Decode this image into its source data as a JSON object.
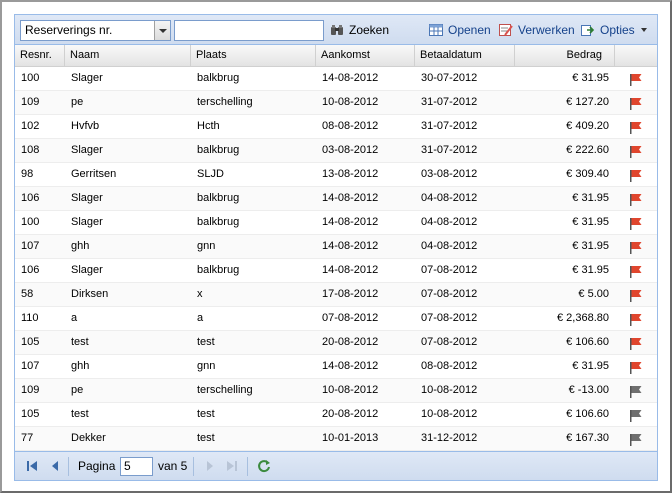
{
  "toolbar": {
    "filter_field": "Reserverings nr.",
    "search_value": "",
    "search_label": "Zoeken",
    "open_label": "Openen",
    "process_label": "Verwerken",
    "options_label": "Opties"
  },
  "columns": [
    "Resnr.",
    "Naam",
    "Plaats",
    "Aankomst",
    "Betaaldatum",
    "Bedrag"
  ],
  "rows": [
    {
      "resnr": "100",
      "naam": "Slager",
      "plaats": "balkbrug",
      "aankomst": "14-08-2012",
      "betaaldatum": "30-07-2012",
      "bedrag": "€ 31.95",
      "flag": "red"
    },
    {
      "resnr": "109",
      "naam": "pe",
      "plaats": "terschelling",
      "aankomst": "10-08-2012",
      "betaaldatum": "31-07-2012",
      "bedrag": "€ 127.20",
      "flag": "red"
    },
    {
      "resnr": "102",
      "naam": "Hvfvb",
      "plaats": "Hcth",
      "aankomst": "08-08-2012",
      "betaaldatum": "31-07-2012",
      "bedrag": "€ 409.20",
      "flag": "red"
    },
    {
      "resnr": "108",
      "naam": "Slager",
      "plaats": "balkbrug",
      "aankomst": "03-08-2012",
      "betaaldatum": "31-07-2012",
      "bedrag": "€ 222.60",
      "flag": "red"
    },
    {
      "resnr": "98",
      "naam": "Gerritsen",
      "plaats": "SLJD",
      "aankomst": "13-08-2012",
      "betaaldatum": "03-08-2012",
      "bedrag": "€ 309.40",
      "flag": "red"
    },
    {
      "resnr": "106",
      "naam": "Slager",
      "plaats": "balkbrug",
      "aankomst": "14-08-2012",
      "betaaldatum": "04-08-2012",
      "bedrag": "€ 31.95",
      "flag": "red"
    },
    {
      "resnr": "100",
      "naam": "Slager",
      "plaats": "balkbrug",
      "aankomst": "14-08-2012",
      "betaaldatum": "04-08-2012",
      "bedrag": "€ 31.95",
      "flag": "red"
    },
    {
      "resnr": "107",
      "naam": "ghh",
      "plaats": "gnn",
      "aankomst": "14-08-2012",
      "betaaldatum": "04-08-2012",
      "bedrag": "€ 31.95",
      "flag": "red"
    },
    {
      "resnr": "106",
      "naam": "Slager",
      "plaats": "balkbrug",
      "aankomst": "14-08-2012",
      "betaaldatum": "07-08-2012",
      "bedrag": "€ 31.95",
      "flag": "red"
    },
    {
      "resnr": "58",
      "naam": "Dirksen",
      "plaats": "x",
      "aankomst": "17-08-2012",
      "betaaldatum": "07-08-2012",
      "bedrag": "€ 5.00",
      "flag": "red"
    },
    {
      "resnr": "110",
      "naam": "a",
      "plaats": "a",
      "aankomst": "07-08-2012",
      "betaaldatum": "07-08-2012",
      "bedrag": "€ 2,368.80",
      "flag": "red"
    },
    {
      "resnr": "105",
      "naam": "test",
      "plaats": "test",
      "aankomst": "20-08-2012",
      "betaaldatum": "07-08-2012",
      "bedrag": "€ 106.60",
      "flag": "red"
    },
    {
      "resnr": "107",
      "naam": "ghh",
      "plaats": "gnn",
      "aankomst": "14-08-2012",
      "betaaldatum": "08-08-2012",
      "bedrag": "€ 31.95",
      "flag": "red"
    },
    {
      "resnr": "109",
      "naam": "pe",
      "plaats": "terschelling",
      "aankomst": "10-08-2012",
      "betaaldatum": "10-08-2012",
      "bedrag": "€ -13.00",
      "flag": "grey"
    },
    {
      "resnr": "105",
      "naam": "test",
      "plaats": "test",
      "aankomst": "20-08-2012",
      "betaaldatum": "10-08-2012",
      "bedrag": "€ 106.60",
      "flag": "grey"
    },
    {
      "resnr": "77",
      "naam": "Dekker",
      "plaats": "test",
      "aankomst": "10-01-2013",
      "betaaldatum": "31-12-2012",
      "bedrag": "€ 167.30",
      "flag": "grey"
    }
  ],
  "paging": {
    "page_label": "Pagina",
    "current_page": "5",
    "of_label": "van 5"
  },
  "colors": {
    "flag_red": "#e0462e",
    "flag_grey": "#6f6f6f",
    "accent": "#15428b"
  }
}
